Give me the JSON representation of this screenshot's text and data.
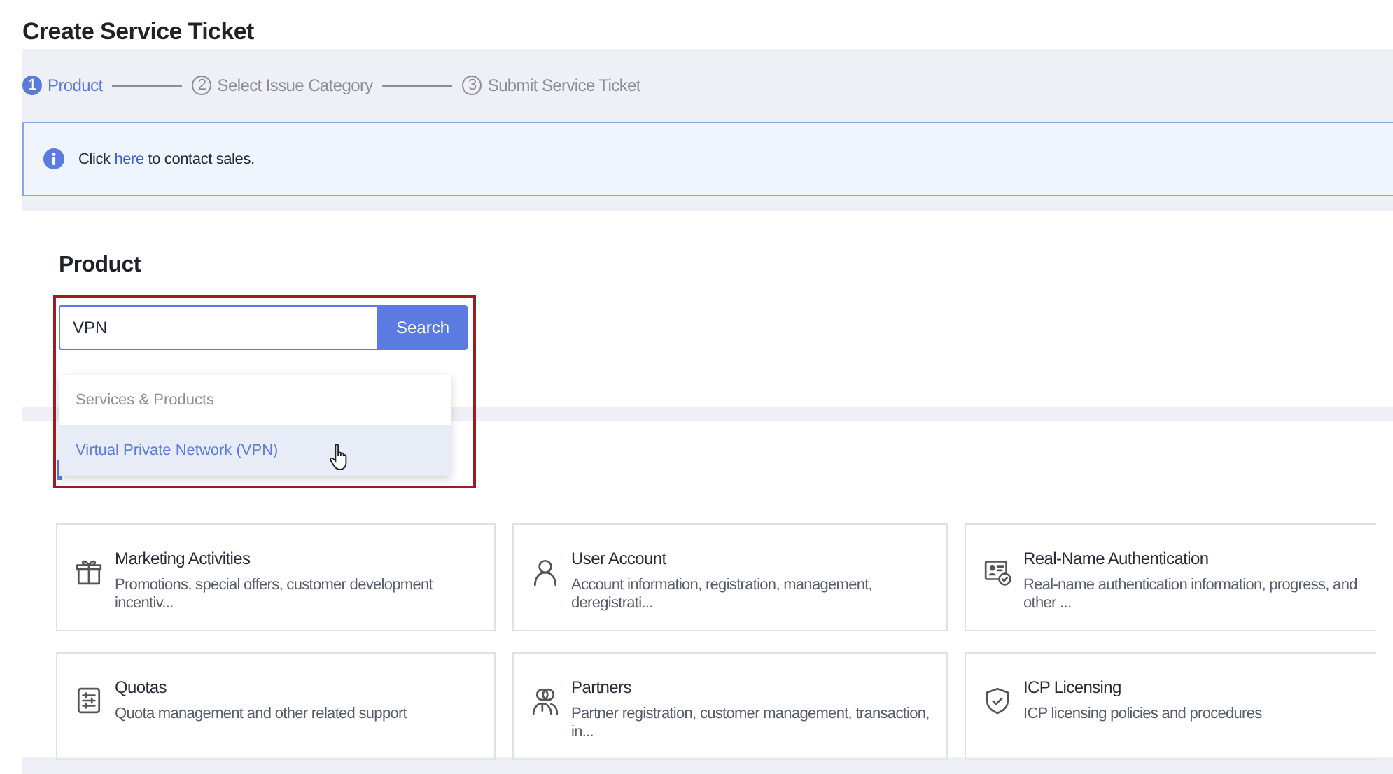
{
  "page_title": "Create Service Ticket",
  "steps": [
    {
      "number": "1",
      "label": "Product",
      "selected": true
    },
    {
      "number": "2",
      "label": "Select Issue Category",
      "selected": false
    },
    {
      "number": "3",
      "label": "Submit Service Ticket",
      "selected": false
    }
  ],
  "notice": {
    "before": "Click ",
    "link": "here",
    "after": " to contact sales."
  },
  "product": {
    "heading": "Product",
    "search_value": "VPN",
    "search_button": "Search",
    "dropdown": {
      "group": "Services & Products",
      "items": [
        {
          "label": "Virtual Private Network (VPN)",
          "selected": true
        }
      ]
    }
  },
  "categories": [
    {
      "title": "Marketing Activities",
      "description": "Promotions, special offers, customer development incentiv..."
    },
    {
      "title": "User Account",
      "description": "Account information, registration, management, deregistrati..."
    },
    {
      "title": "Real-Name Authentication",
      "description": "Real-name authentication information, progress, and other ..."
    },
    {
      "title": "Quotas",
      "description": "Quota management and other related support"
    },
    {
      "title": "Partners",
      "description": "Partner registration, customer management, transaction, in..."
    },
    {
      "title": "ICP Licensing",
      "description": "ICP licensing policies and procedures"
    }
  ]
}
